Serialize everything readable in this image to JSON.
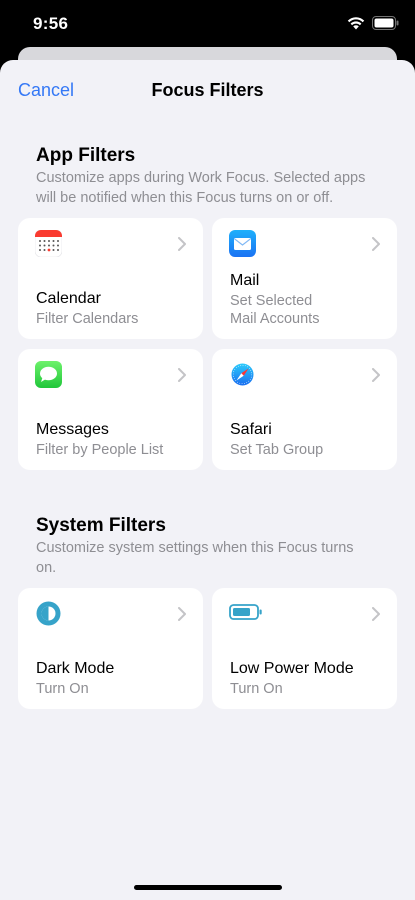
{
  "status_bar": {
    "time": "9:56"
  },
  "nav": {
    "cancel_label": "Cancel",
    "title": "Focus Filters"
  },
  "app_filters": {
    "title": "App Filters",
    "description": "Customize apps during Work Focus. Selected apps will be notified when this Focus turns on or off.",
    "cards": [
      {
        "title": "Calendar",
        "subtitle": "Filter Calendars",
        "icon": "calendar-icon"
      },
      {
        "title": "Mail",
        "subtitle": "Set Selected Mail Accounts",
        "icon": "mail-icon"
      },
      {
        "title": "Messages",
        "subtitle": "Filter by People List",
        "icon": "messages-icon"
      },
      {
        "title": "Safari",
        "subtitle": "Set Tab Group",
        "icon": "safari-icon"
      }
    ]
  },
  "system_filters": {
    "title": "System Filters",
    "description": "Customize system settings when this Focus turns on.",
    "cards": [
      {
        "title": "Dark Mode",
        "subtitle": "Turn On",
        "icon": "dark-mode-icon"
      },
      {
        "title": "Low Power Mode",
        "subtitle": "Turn On",
        "icon": "low-power-battery-icon"
      }
    ]
  },
  "colors": {
    "accent": "#3478f6",
    "background": "#f2f2f7",
    "secondary_text": "#8e8e93"
  }
}
